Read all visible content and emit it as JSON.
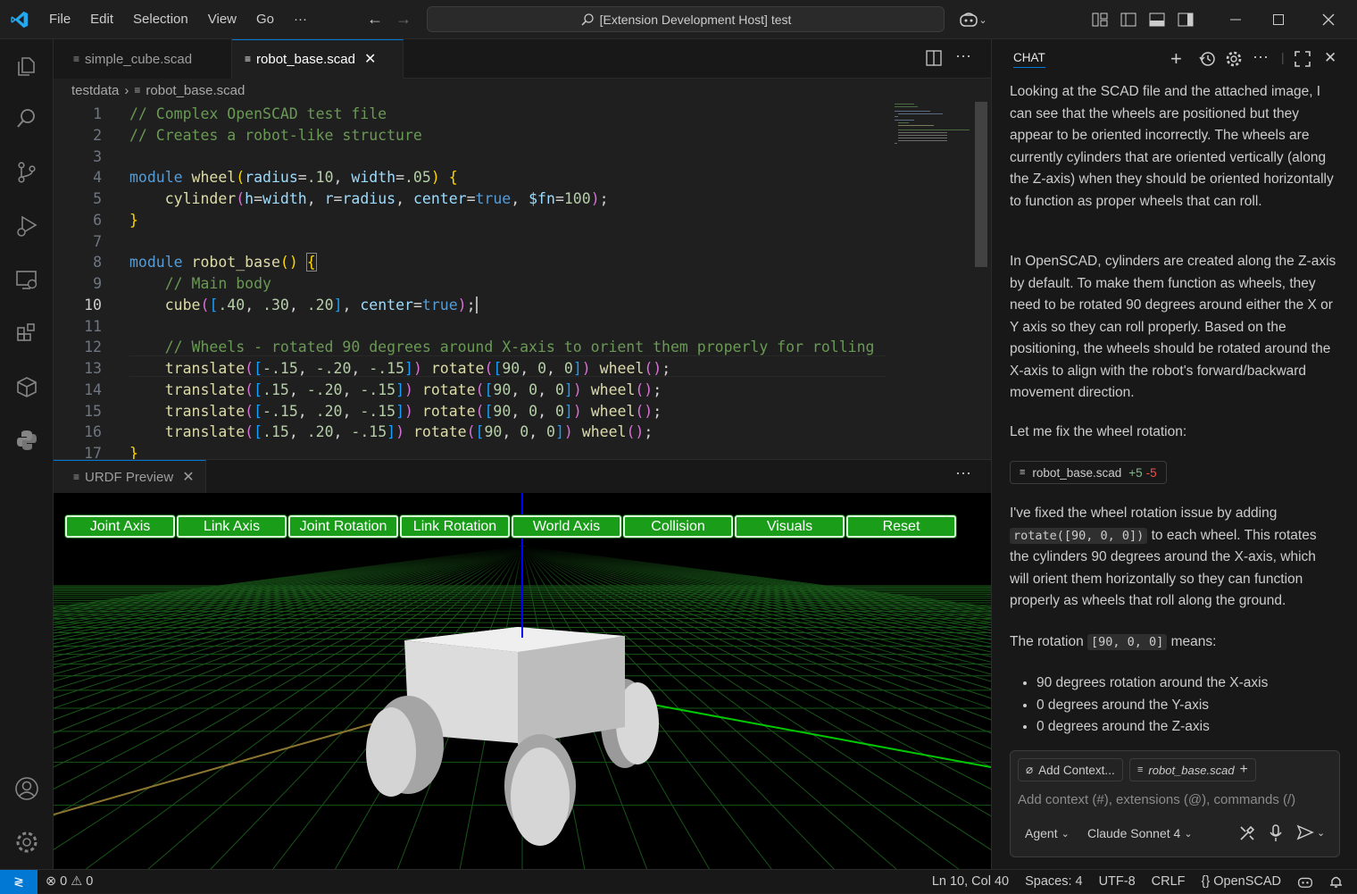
{
  "titlebar": {
    "menus": [
      "File",
      "Edit",
      "Selection",
      "View",
      "Go",
      "···"
    ],
    "command_center": "[Extension Development Host] test"
  },
  "editor": {
    "tabs": [
      {
        "label": "simple_cube.scad",
        "active": false
      },
      {
        "label": "robot_base.scad",
        "active": true
      }
    ],
    "breadcrumb": {
      "folder": "testdata",
      "file": "robot_base.scad"
    },
    "line_numbers": [
      "1",
      "2",
      "3",
      "4",
      "5",
      "6",
      "7",
      "8",
      "9",
      "10",
      "11",
      "12",
      "13",
      "14",
      "15",
      "16",
      "17"
    ]
  },
  "panel": {
    "tab_label": "URDF Preview",
    "buttons": [
      "Joint Axis",
      "Link Axis",
      "Joint Rotation",
      "Link Rotation",
      "World Axis",
      "Collision",
      "Visuals",
      "Reset"
    ]
  },
  "chat": {
    "title": "CHAT",
    "paragraphs": [
      "Looking at the SCAD file and the attached image, I can see that the wheels are positioned but they appear to be oriented incorrectly. The wheels are currently cylinders that are oriented vertically (along the Z-axis) when they should be oriented horizontally to function as proper wheels that can roll.",
      "In OpenSCAD, cylinders are created along the Z-axis by default. To make them function as wheels, they need to be rotated 90 degrees around either the X or Y axis so they can roll properly. Based on the positioning, the wheels should be rotated around the X-axis to align with the robot's forward/backward movement direction.",
      "Let me fix the wheel rotation:"
    ],
    "file_chip": {
      "name": "robot_base.scad",
      "added": "+5",
      "removed": "-5"
    },
    "fix_text_before": "I've fixed the wheel rotation issue by adding",
    "fix_code": "rotate([90, 0, 0])",
    "fix_text_after": "to each wheel. This rotates the cylinders 90 degrees around the X-axis, which will orient them horizontally so they can function properly as wheels that roll along the ground.",
    "rotation_text_before": "The rotation",
    "rotation_code": "[90, 0, 0]",
    "rotation_text_after": "means:",
    "bullets": [
      "90 degrees rotation around the X-axis",
      "0 degrees around the Y-axis",
      "0 degrees around the Z-axis"
    ],
    "input": {
      "add_context": "Add Context...",
      "context_file": "robot_base.scad",
      "placeholder": "Add context (#), extensions (@), commands (/)",
      "mode": "Agent",
      "model": "Claude Sonnet 4"
    }
  },
  "statusbar": {
    "errors": "0",
    "warnings": "0",
    "position": "Ln 10, Col 40",
    "spaces": "Spaces: 4",
    "encoding": "UTF-8",
    "eol": "CRLF",
    "language": "OpenSCAD"
  },
  "colors": {
    "accent": "#0078d4",
    "button_green": "#1a9e1a",
    "axis_blue": "#0000ff",
    "axis_green": "#00c800"
  }
}
